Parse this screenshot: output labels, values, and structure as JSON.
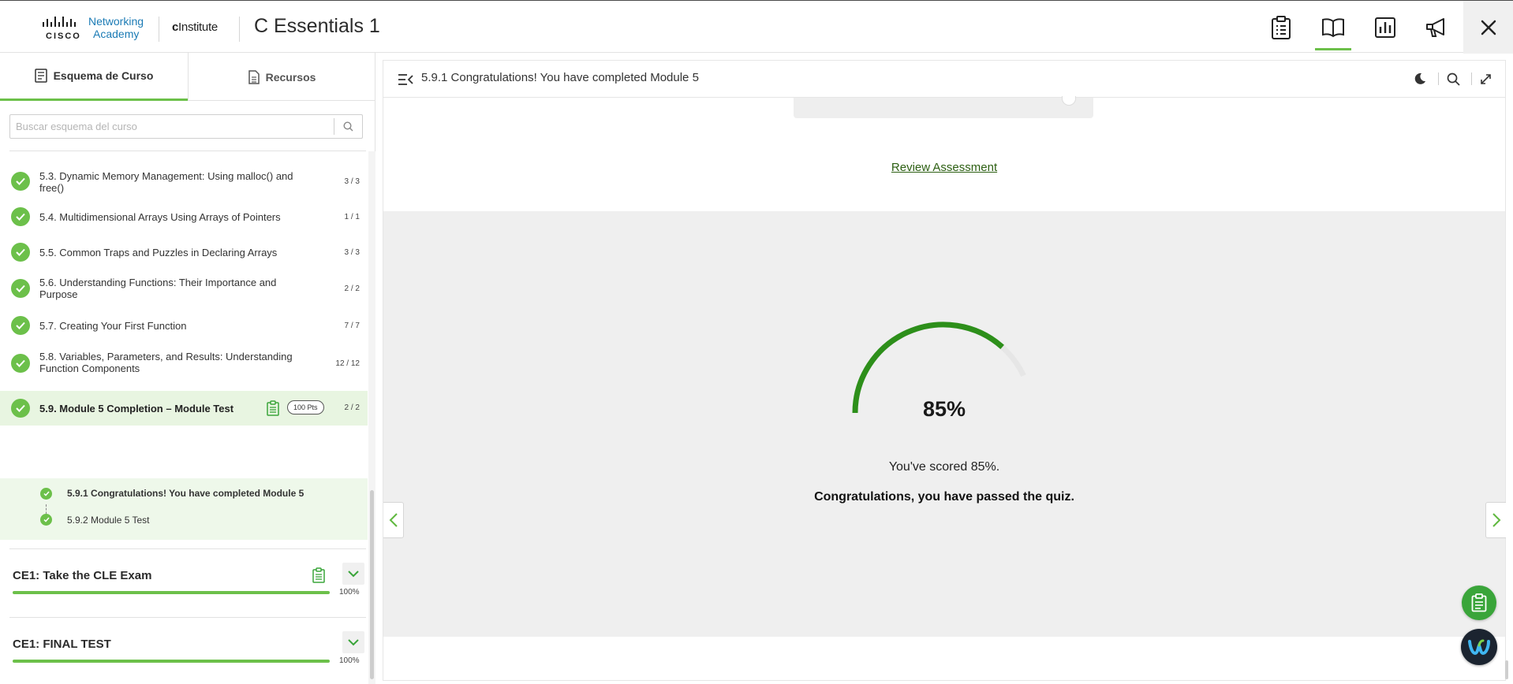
{
  "header": {
    "brand_networking": "Networking",
    "brand_academy": "Academy",
    "brand_cisco": "CISCO",
    "partner_logo": "Institute",
    "course_title": "C Essentials 1",
    "icons": [
      "clipboard-icon",
      "book-icon",
      "bar-chart-icon",
      "megaphone-icon",
      "close-icon"
    ]
  },
  "sidebar": {
    "tabs": [
      {
        "label": "Esquema de Curso",
        "icon": "outline-icon",
        "active": true
      },
      {
        "label": "Recursos",
        "icon": "document-icon",
        "active": false
      }
    ],
    "search": {
      "placeholder": "Buscar esquema del curso",
      "value": ""
    },
    "items": [
      {
        "label": "5.3. Dynamic Memory Management: Using malloc() and free()",
        "count": "3 / 3"
      },
      {
        "label": "5.4. Multidimensional Arrays Using Arrays of Pointers",
        "count": "1 / 1"
      },
      {
        "label": "5.5. Common Traps and Puzzles in Declaring Arrays",
        "count": "3 / 3"
      },
      {
        "label": "5.6. Understanding Functions: Their Importance and Purpose",
        "count": "2 / 2"
      },
      {
        "label": "5.7. Creating Your First Function",
        "count": "7 / 7"
      },
      {
        "label": "5.8. Variables, Parameters, and Results: Understanding Function Components",
        "count": "12 / 12"
      },
      {
        "label": "5.9. Module 5 Completion – Module Test",
        "count": "2 / 2",
        "points": "100 Pts",
        "active": true
      }
    ],
    "subitems": [
      {
        "label": "5.9.1 Congratulations! You have completed Module 5",
        "current": true
      },
      {
        "label": "5.9.2 Module 5 Test",
        "current": false
      }
    ],
    "sections": [
      {
        "title": "CE1: Take the CLE Exam",
        "percent": "100%",
        "progress": 1.0
      },
      {
        "title": "CE1: FINAL TEST",
        "percent": "100%",
        "progress": 1.0
      }
    ]
  },
  "main": {
    "title": "5.9.1 Congratulations! You have completed Module 5",
    "review_link": "Review Assessment",
    "score_percent": "85%",
    "score_value": 0.85,
    "score_text": "You've scored 85%.",
    "pass_text": "Congratulations, you have passed the quiz."
  },
  "colors": {
    "accent": "#6cc04a",
    "gauge": "#2d8f1a",
    "link": "#2c5f12",
    "brand_blue": "#1b7bb5"
  }
}
